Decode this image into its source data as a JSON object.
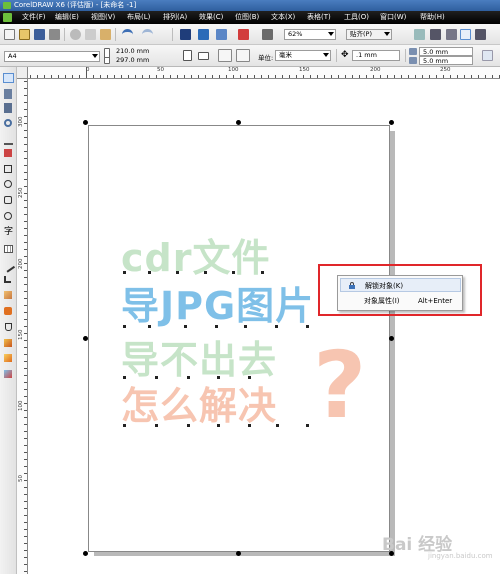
{
  "window": {
    "title": "CorelDRAW X6 (评估版) - [未命名 -1]"
  },
  "menu": [
    "文件(F)",
    "编辑(E)",
    "视图(V)",
    "布局(L)",
    "排列(A)",
    "效果(C)",
    "位图(B)",
    "文本(X)",
    "表格(T)",
    "工具(O)",
    "窗口(W)",
    "帮助(H)"
  ],
  "toolbar": {
    "zoom": "62%",
    "snap": "贴齐(P)"
  },
  "property_bar": {
    "page_size": "A4",
    "width": "210.0 mm",
    "height": "297.0 mm",
    "units_label": "单位:",
    "units_value": "毫米",
    "nudge": ".1 mm",
    "dup_x": "5.0 mm",
    "dup_y": "5.0 mm"
  },
  "ruler": {
    "top": [
      "0",
      "50",
      "100",
      "150",
      "200",
      "250"
    ],
    "left": [
      "300",
      "250",
      "200",
      "150",
      "100",
      "50"
    ]
  },
  "artwork": {
    "line1": "cdr文件",
    "line2": "导JPG图片",
    "line3": "导不出去",
    "line4": "怎么解决",
    "question_mark": "?",
    "colors": {
      "green": "#c6e4c8",
      "blue": "#7fc0e8",
      "orange": "#f7c5b1"
    }
  },
  "context_menu": {
    "items": [
      {
        "label": "解锁对象(K)",
        "shortcut": "",
        "icon": "unlock-icon",
        "highlighted": true
      },
      {
        "label": "对象属性(I)",
        "shortcut": "Alt+Enter",
        "icon": "",
        "highlighted": false
      }
    ],
    "highlight_color": "#e0262a"
  },
  "watermark": {
    "text": "Bai 经验",
    "subtext": "jingyan.baidu.com"
  }
}
